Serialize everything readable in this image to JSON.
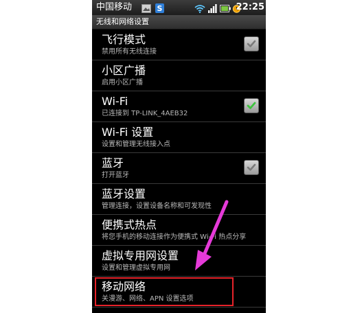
{
  "status_bar": {
    "carrier": "中国移动",
    "time": "22:25",
    "icons": [
      "image-icon",
      "sync-icon",
      "wifi-icon",
      "signal-icon",
      "battery-icon",
      "alarm-icon"
    ]
  },
  "title_bar": {
    "title": "无线和网络设置"
  },
  "items": [
    {
      "title": "飞行模式",
      "subtitle": "禁用所有无线连接",
      "checkbox": "unchecked"
    },
    {
      "title": "小区广播",
      "subtitle": "启用小区广播"
    },
    {
      "title": "Wi-Fi",
      "subtitle": "已连接到 TP-LINK_4AEB32",
      "checkbox": "checked"
    },
    {
      "title": "Wi-Fi 设置",
      "subtitle": "设置和管理无线接入点"
    },
    {
      "title": "蓝牙",
      "subtitle": "打开蓝牙",
      "checkbox": "unchecked"
    },
    {
      "title": "蓝牙设置",
      "subtitle": "管理连接，设置设备名称和可发现性"
    },
    {
      "title": "便携式热点",
      "subtitle": "将您手机的移动连接作为便携式 Wi-Fi 热点分享"
    },
    {
      "title": "虚拟专用网设置",
      "subtitle": "设置和管理虚拟专用网"
    },
    {
      "title": "移动网络",
      "subtitle": "关漫游、网络、APN 设置选项"
    }
  ],
  "colors": {
    "highlight": "#e8232a",
    "arrow": "#e53ad8",
    "check": "#3cc23c"
  }
}
